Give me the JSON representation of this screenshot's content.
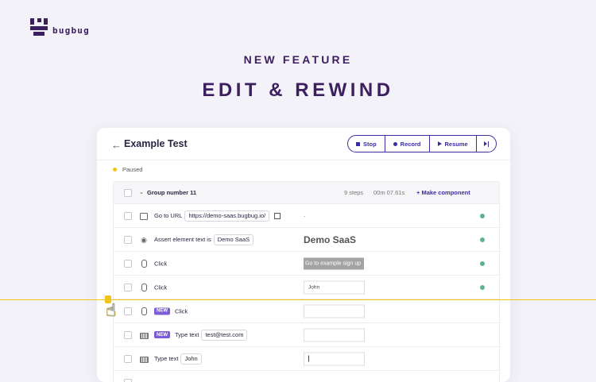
{
  "brand": {
    "name": "bugbug"
  },
  "hero": {
    "kicker": "NEW FEATURE",
    "headline": "EDIT & REWIND"
  },
  "test": {
    "title": "Example Test",
    "controls": {
      "stop": "Stop",
      "record": "Record",
      "resume": "Resume"
    },
    "status": "Paused",
    "group": {
      "name": "Group number 11",
      "steps": "9 steps",
      "duration": "00m 07.61s",
      "make_component": "+ Make component"
    },
    "rows": [
      {
        "icon": "browser-icon",
        "text": "Go to URL",
        "param": "https://demo-saas.bugbug.io/",
        "badge": "",
        "preview": "-",
        "done": true
      },
      {
        "icon": "eye-icon",
        "text": "Assert element text is",
        "param": "Demo SaaS",
        "badge": "",
        "preview": "Demo SaaS",
        "done": true
      },
      {
        "icon": "mouse-icon",
        "text": "Click",
        "param": "",
        "badge": "",
        "preview": "Go to example sign up",
        "done": true
      },
      {
        "icon": "mouse-icon",
        "text": "Click",
        "param": "",
        "badge": "",
        "preview": "John",
        "done": true
      },
      {
        "icon": "mouse-icon",
        "text": "Click",
        "param": "",
        "badge": "NEW",
        "preview": "",
        "done": false
      },
      {
        "icon": "keyboard-icon",
        "text": "Type text",
        "param": "test@test.com",
        "badge": "NEW",
        "preview": "",
        "done": false
      },
      {
        "icon": "keyboard-icon",
        "text": "Type text",
        "param": "John",
        "badge": "",
        "preview": "",
        "done": false
      }
    ]
  },
  "colors": {
    "brand": "#3b1f5e",
    "accent": "#3b2ea0",
    "highlight": "#f0c419",
    "success": "#5db48a",
    "new_badge": "#7b5cd6"
  }
}
